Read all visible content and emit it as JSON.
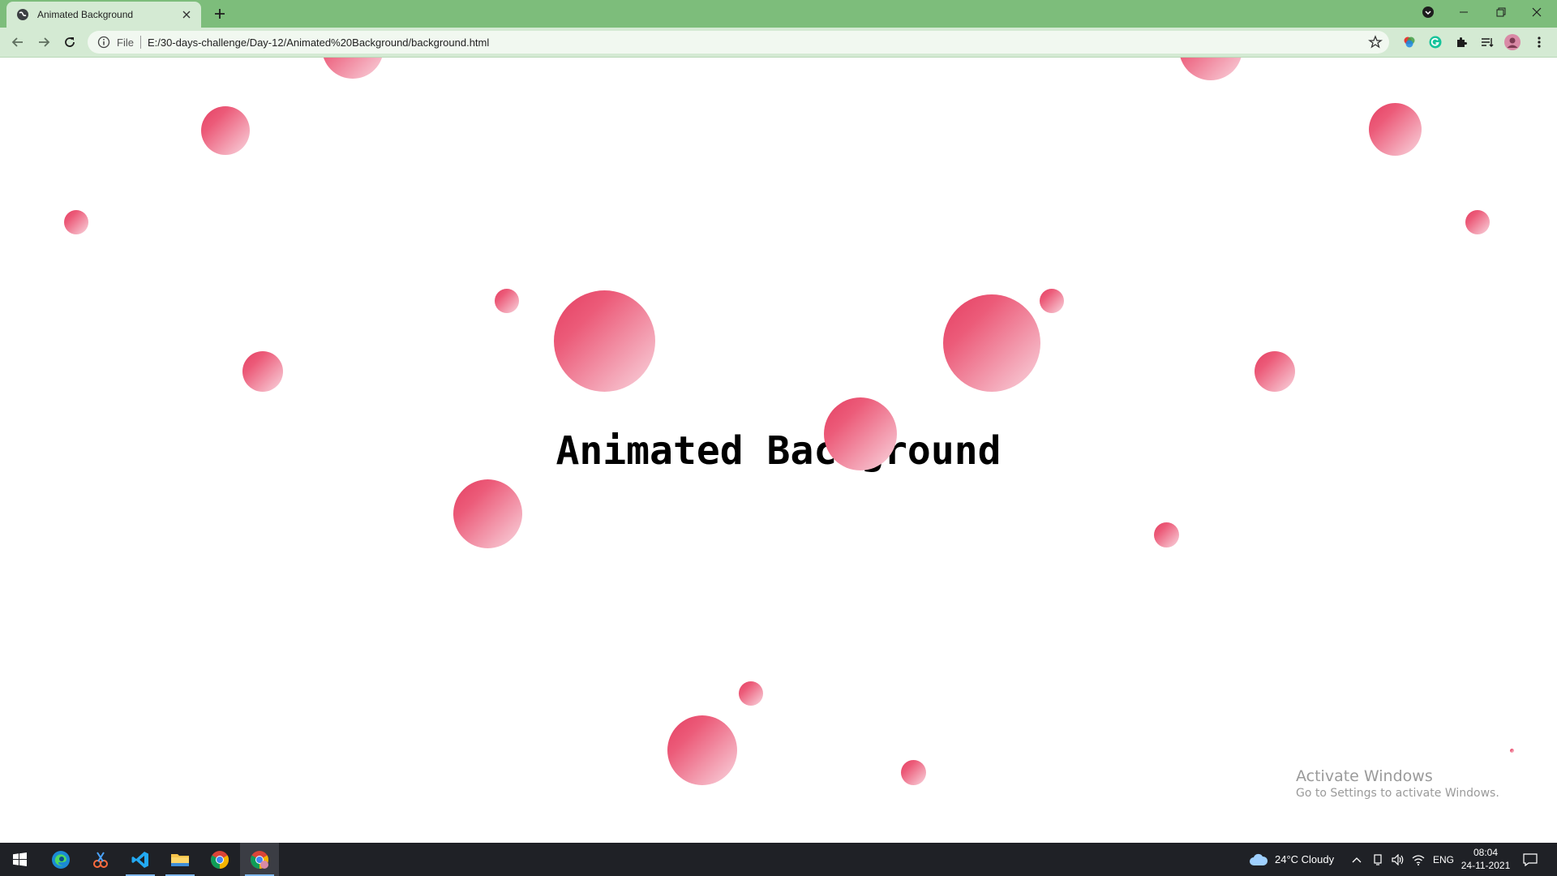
{
  "browser": {
    "tab_title": "Animated Background",
    "address": {
      "scheme_label": "File",
      "url": "E:/30-days-challenge/Day-12/Animated%20Background/background.html"
    }
  },
  "page": {
    "heading": "Animated Background",
    "bubble_color_top": "#e43f62",
    "bubble_color_bottom": "#f9d6df"
  },
  "watermark": {
    "title": "Activate Windows",
    "subtitle": "Go to Settings to activate Windows."
  },
  "taskbar": {
    "weather": "24°C  Cloudy",
    "language": "ENG",
    "time": "08:04",
    "date": "24-11-2021"
  },
  "icons": {
    "accent": "#7dbd7b",
    "taskbar_bg": "#1f2126"
  }
}
